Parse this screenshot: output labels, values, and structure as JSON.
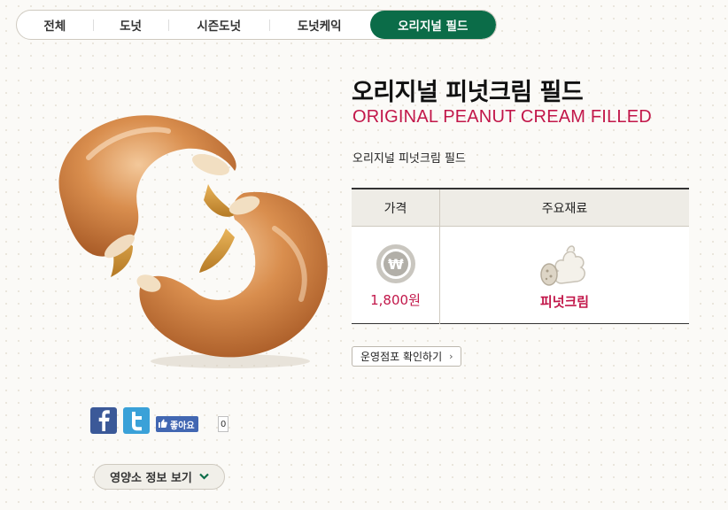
{
  "tabs": [
    {
      "label": "전체"
    },
    {
      "label": "도넛"
    },
    {
      "label": "시즌도넛"
    },
    {
      "label": "도넛케익"
    },
    {
      "label": "오리지널 필드",
      "active": true
    }
  ],
  "product": {
    "name_ko": "오리지널 피넛크림 필드",
    "name_en": "ORIGINAL PEANUT CREAM FILLED",
    "description": "오리지널 피넛크림 필드",
    "image_icon": "peanut-cream-donut-photo"
  },
  "info_table": {
    "headers": [
      "가격",
      "주요재료"
    ],
    "price": "1,800원",
    "ingredient": "피넛크림",
    "price_icon": "won-coin-icon",
    "ingredient_icon": "cream-peanut-icon"
  },
  "store_button": {
    "label": "운영점포 확인하기"
  },
  "social": {
    "like_label": "좋아요",
    "like_count": "0"
  },
  "nutrition_button": {
    "label": "영양소 정보 보기"
  },
  "colors": {
    "accent_green": "#0b6c48",
    "accent_red": "#c2174a",
    "facebook": "#3b5998",
    "twitter": "#3aa1d8"
  }
}
